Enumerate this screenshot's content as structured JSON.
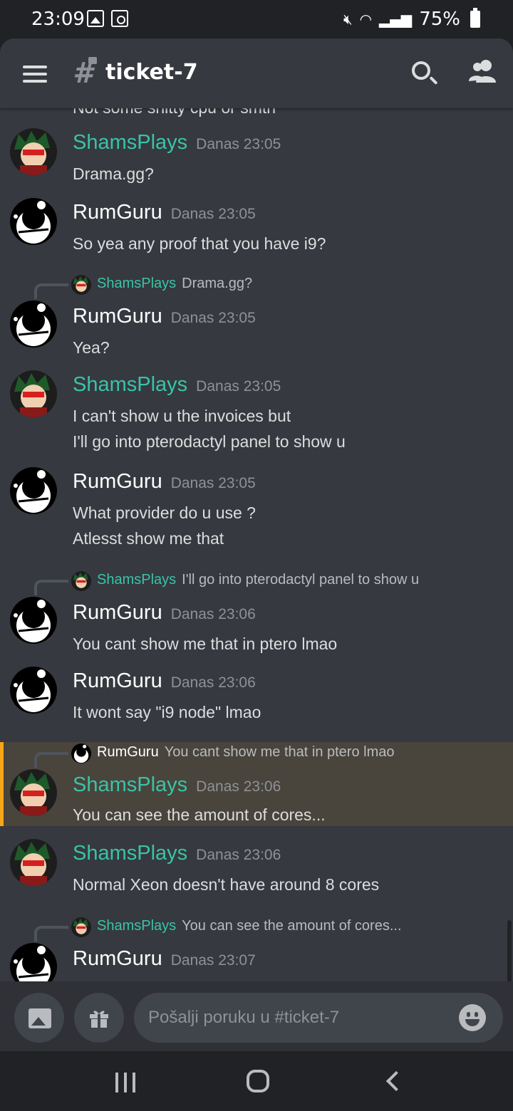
{
  "status_bar": {
    "time": "23:09",
    "battery": "75%"
  },
  "header": {
    "channel": "ticket-7"
  },
  "cutoff_text": "Not some shitty cpu or smth",
  "messages": [
    {
      "user": "ShamsPlays",
      "time": "Danas 23:05",
      "lines": [
        "Drama.gg?"
      ]
    },
    {
      "user": "RumGuru",
      "time": "Danas 23:05",
      "lines": [
        "So yea any proof that you have i9?"
      ]
    },
    {
      "reply_user": "ShamsPlays",
      "reply_text": "Drama.gg?",
      "user": "RumGuru",
      "time": "Danas 23:05",
      "lines": [
        "Yea?"
      ]
    },
    {
      "user": "ShamsPlays",
      "time": "Danas 23:05",
      "lines": [
        "I can't show u the invoices but",
        "I'll go into pterodactyl panel to show u"
      ]
    },
    {
      "user": "RumGuru",
      "time": "Danas 23:05",
      "lines": [
        "What provider do u use ?",
        "Atlesst show me that"
      ]
    },
    {
      "reply_user": "ShamsPlays",
      "reply_text": "I'll go into pterodactyl panel to show u",
      "user": "RumGuru",
      "time": "Danas 23:06",
      "lines": [
        "You cant show me that in ptero lmao"
      ]
    },
    {
      "user": "RumGuru",
      "time": "Danas 23:06",
      "lines": [
        "It wont say \"i9 node\" lmao"
      ]
    },
    {
      "reply_user": "RumGuru",
      "reply_text": "You cant show me that in ptero lmao",
      "user": "ShamsPlays",
      "time": "Danas 23:06",
      "lines": [
        "You can see the amount of cores..."
      ]
    },
    {
      "user": "ShamsPlays",
      "time": "Danas 23:06",
      "lines": [
        "Normal Xeon doesn't have around 8 cores"
      ]
    },
    {
      "reply_user": "ShamsPlays",
      "reply_text": "You can see the amount of cores...",
      "user": "RumGuru",
      "time": "Danas 23:07",
      "lines": [
        ""
      ]
    }
  ],
  "input": {
    "placeholder": "Pošalji poruku u #ticket-7"
  },
  "colors": {
    "shams_name": "#38c4a7",
    "highlight_border": "#faa61a",
    "background": "#36393f"
  }
}
